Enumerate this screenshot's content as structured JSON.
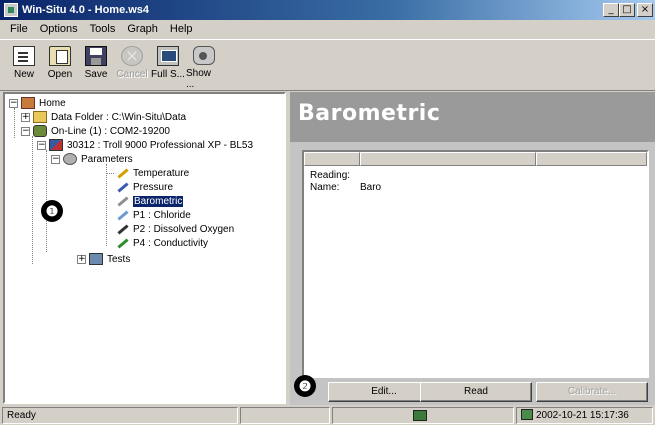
{
  "window": {
    "title": "Win-Situ 4.0 - Home.ws4",
    "buttons": [
      "_",
      "□",
      "×"
    ]
  },
  "menu": [
    "File",
    "Options",
    "Tools",
    "Graph",
    "Help"
  ],
  "toolbar": [
    {
      "label": "New",
      "icon": "new-document-icon",
      "enabled": true
    },
    {
      "label": "Open",
      "icon": "open-folder-icon",
      "enabled": true
    },
    {
      "label": "Save",
      "icon": "save-disk-icon",
      "enabled": true
    },
    {
      "label": "Cancel",
      "icon": "cancel-icon",
      "enabled": false
    },
    {
      "label": "Full S...",
      "icon": "full-screen-icon",
      "enabled": true
    },
    {
      "label": "Show ...",
      "icon": "show-icon",
      "enabled": true
    }
  ],
  "tree": {
    "home": "Home",
    "data_folder": "Data Folder : C:\\Win-Situ\\Data",
    "online": "On-Line (1) : COM2-19200",
    "device": "30312 : Troll 9000 Professional XP - BL53",
    "parameters": "Parameters",
    "params": [
      "Temperature",
      "Pressure",
      "Barometric",
      "P1 : Chloride",
      "P2 : Dissolved Oxygen",
      "P4 : Conductivity"
    ],
    "tests": "Tests"
  },
  "callouts": {
    "one": "❶",
    "two": "❷"
  },
  "detail": {
    "title": "Barometric",
    "reading_label": "Reading:",
    "name_label": "Name:",
    "name_value": "Baro"
  },
  "actions": {
    "edit": "Edit...",
    "read": "Read",
    "calibrate": "Calibrate..."
  },
  "status": {
    "text": "Ready",
    "datetime": "2002-10-21  15:17:36"
  },
  "colors": {
    "selection": "#0a246a",
    "detail_header": "#9a9a9a",
    "detail_bg": "#c4c4c4"
  }
}
